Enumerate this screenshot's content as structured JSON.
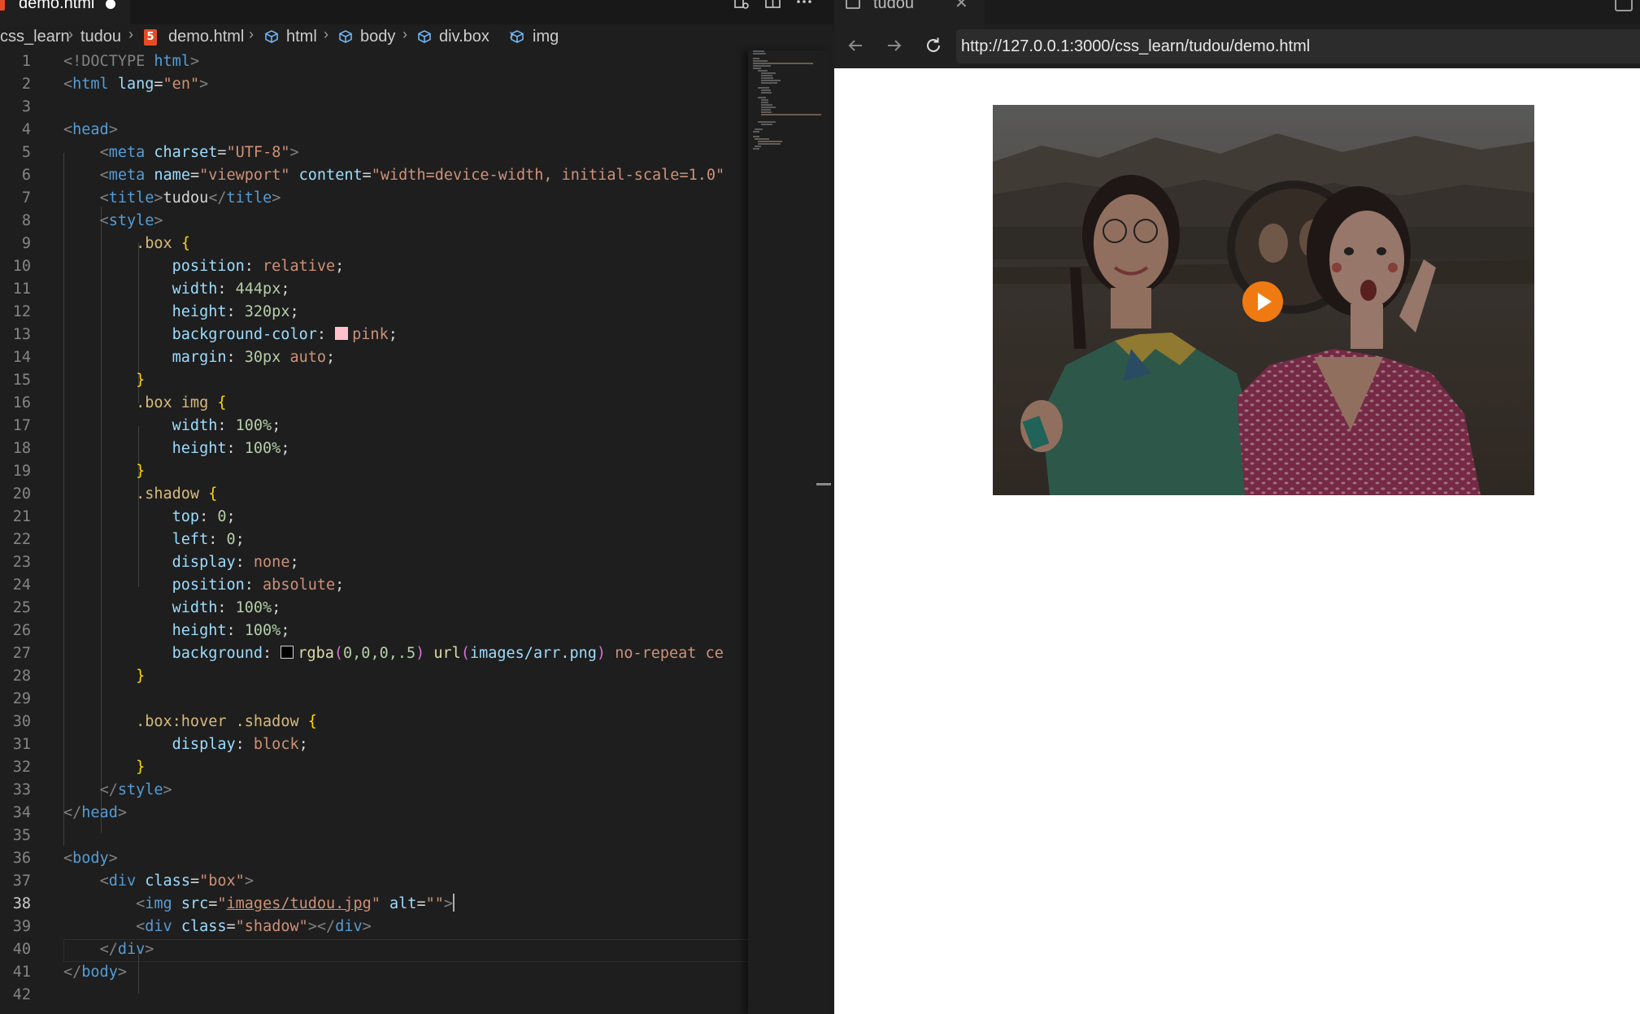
{
  "editor": {
    "tab": {
      "filename": "demo.html"
    },
    "breadcrumbs": [
      "css_learn",
      "tudou",
      "demo.html",
      "html",
      "body",
      "div.box",
      "img"
    ],
    "active_line": 38,
    "lines": [
      {
        "n": "1"
      },
      {
        "n": "2"
      },
      {
        "n": "3"
      },
      {
        "n": "4"
      },
      {
        "n": "5"
      },
      {
        "n": "6"
      },
      {
        "n": "7"
      },
      {
        "n": "8"
      },
      {
        "n": "9"
      },
      {
        "n": "10"
      },
      {
        "n": "11"
      },
      {
        "n": "12"
      },
      {
        "n": "13"
      },
      {
        "n": "14"
      },
      {
        "n": "15"
      },
      {
        "n": "16"
      },
      {
        "n": "17"
      },
      {
        "n": "18"
      },
      {
        "n": "19"
      },
      {
        "n": "20"
      },
      {
        "n": "21"
      },
      {
        "n": "22"
      },
      {
        "n": "23"
      },
      {
        "n": "24"
      },
      {
        "n": "25"
      },
      {
        "n": "26"
      },
      {
        "n": "27"
      },
      {
        "n": "28"
      },
      {
        "n": "29"
      },
      {
        "n": "30"
      },
      {
        "n": "31"
      },
      {
        "n": "32"
      },
      {
        "n": "33"
      },
      {
        "n": "34"
      },
      {
        "n": "35"
      },
      {
        "n": "36"
      },
      {
        "n": "37"
      },
      {
        "n": "38"
      },
      {
        "n": "39"
      },
      {
        "n": "40"
      },
      {
        "n": "41"
      },
      {
        "n": "42"
      }
    ],
    "code": {
      "l1_doctype": "<!DOCTYPE",
      "l1_html": "html",
      "l2_tag": "html",
      "l2_attr": "lang",
      "l2_val": "\"en\"",
      "l4_tag": "head",
      "l5_tag": "meta",
      "l5_attr": "charset",
      "l5_val": "\"UTF-8\"",
      "l6_tag": "meta",
      "l6_attr1": "name",
      "l6_val1": "\"viewport\"",
      "l6_attr2": "content",
      "l6_val2": "\"width=device-width, initial-scale=1.0\"",
      "l7_tag": "title",
      "l7_text": "tudou",
      "l8_tag": "style",
      "l9_sel": ".box",
      "l10_prop": "position",
      "l10_val": "relative",
      "l11_prop": "width",
      "l11_val": "444px",
      "l12_prop": "height",
      "l12_val": "320px",
      "l13_prop": "background-color",
      "l13_val": "pink",
      "l14_prop": "margin",
      "l14_num": "30px",
      "l14_val": "auto",
      "l16_sel": ".box img",
      "l17_prop": "width",
      "l17_val": "100%",
      "l18_prop": "height",
      "l18_val": "100%",
      "l20_sel": ".shadow",
      "l21_prop": "top",
      "l21_val": "0",
      "l22_prop": "left",
      "l22_val": "0",
      "l23_prop": "display",
      "l23_val": "none",
      "l24_prop": "position",
      "l24_val": "absolute",
      "l25_prop": "width",
      "l25_val": "100%",
      "l26_prop": "height",
      "l26_val": "100%",
      "l27_prop": "background",
      "l27_fn": "rgba",
      "l27_args": "0,0,0,.5",
      "l27_url": "url",
      "l27_path": "images/arr.png",
      "l27_rest": "no-repeat ce",
      "l30_sel": ".box:hover .shadow",
      "l31_prop": "display",
      "l31_val": "block",
      "l33_tag": "style",
      "l34_tag": "head",
      "l36_tag": "body",
      "l37_tag": "div",
      "l37_attr": "class",
      "l37_val": "\"box\"",
      "l38_tag": "img",
      "l38_attr1": "src",
      "l38_val1": "images/tudou.jpg",
      "l38_attr2": "alt",
      "l38_val2": "\"\"",
      "l39_tag": "div",
      "l39_attr": "class",
      "l39_val": "\"shadow\"",
      "l39_close": "div",
      "l40_tag": "div",
      "l41_tag": "body"
    }
  },
  "browser": {
    "tab_title": "tudou",
    "url": "http://127.0.0.1:3000/css_learn/tudou/demo.html"
  },
  "colors": {
    "box_bg": "#ffc0cb",
    "play_button": "#f07a12",
    "pink_swatch": "#ffc0cb"
  },
  "icons": {
    "back": "arrow-left-icon",
    "forward": "arrow-right-icon",
    "reload": "reload-icon",
    "play": "play-icon"
  }
}
